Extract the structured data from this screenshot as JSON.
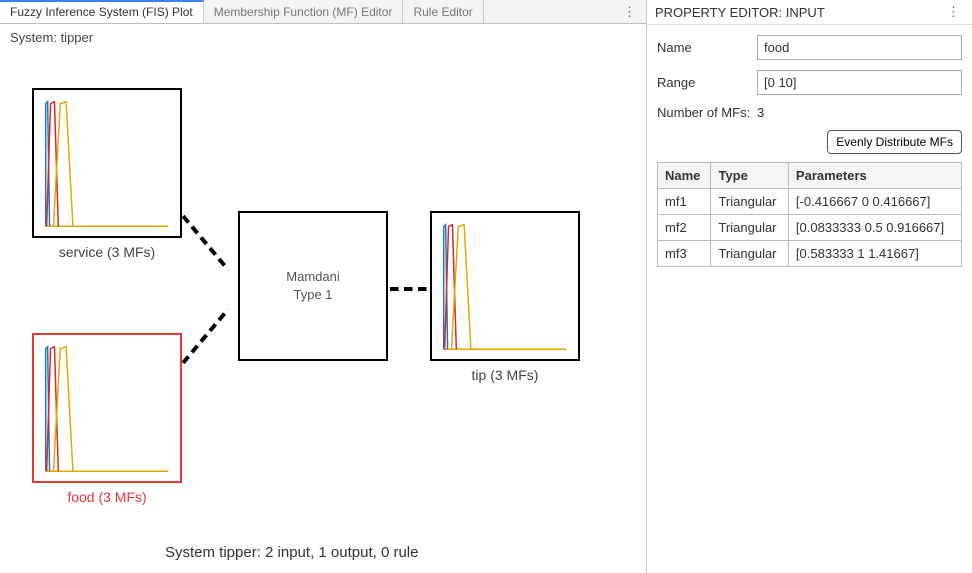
{
  "tabs": {
    "fis_plot": "Fuzzy Inference System (FIS) Plot",
    "mf_editor": "Membership Function (MF) Editor",
    "rule_editor": "Rule Editor"
  },
  "system_label": "System: tipper",
  "nodes": {
    "service": {
      "label": "service (3 MFs)"
    },
    "food": {
      "label": "food (3 MFs)"
    },
    "inference": {
      "line1": "Mamdani",
      "line2": "Type 1"
    },
    "tip": {
      "label": "tip (3 MFs)"
    }
  },
  "summary": "System tipper: 2 input, 1 output, 0 rule",
  "property_editor": {
    "title": "PROPERTY EDITOR: INPUT",
    "name_label": "Name",
    "name_value": "food",
    "range_label": "Range",
    "range_value": "[0 10]",
    "num_mfs_label": "Number of MFs:",
    "num_mfs_value": "3",
    "dist_btn": "Evenly Distribute MFs",
    "table_headers": {
      "name": "Name",
      "type": "Type",
      "params": "Parameters"
    },
    "rows": [
      {
        "name": "mf1",
        "type": "Triangular",
        "params": "[-0.416667 0 0.416667]"
      },
      {
        "name": "mf2",
        "type": "Triangular",
        "params": "[0.0833333 0.5 0.916667]"
      },
      {
        "name": "mf3",
        "type": "Triangular",
        "params": "[0.583333 1 1.41667]"
      }
    ]
  }
}
